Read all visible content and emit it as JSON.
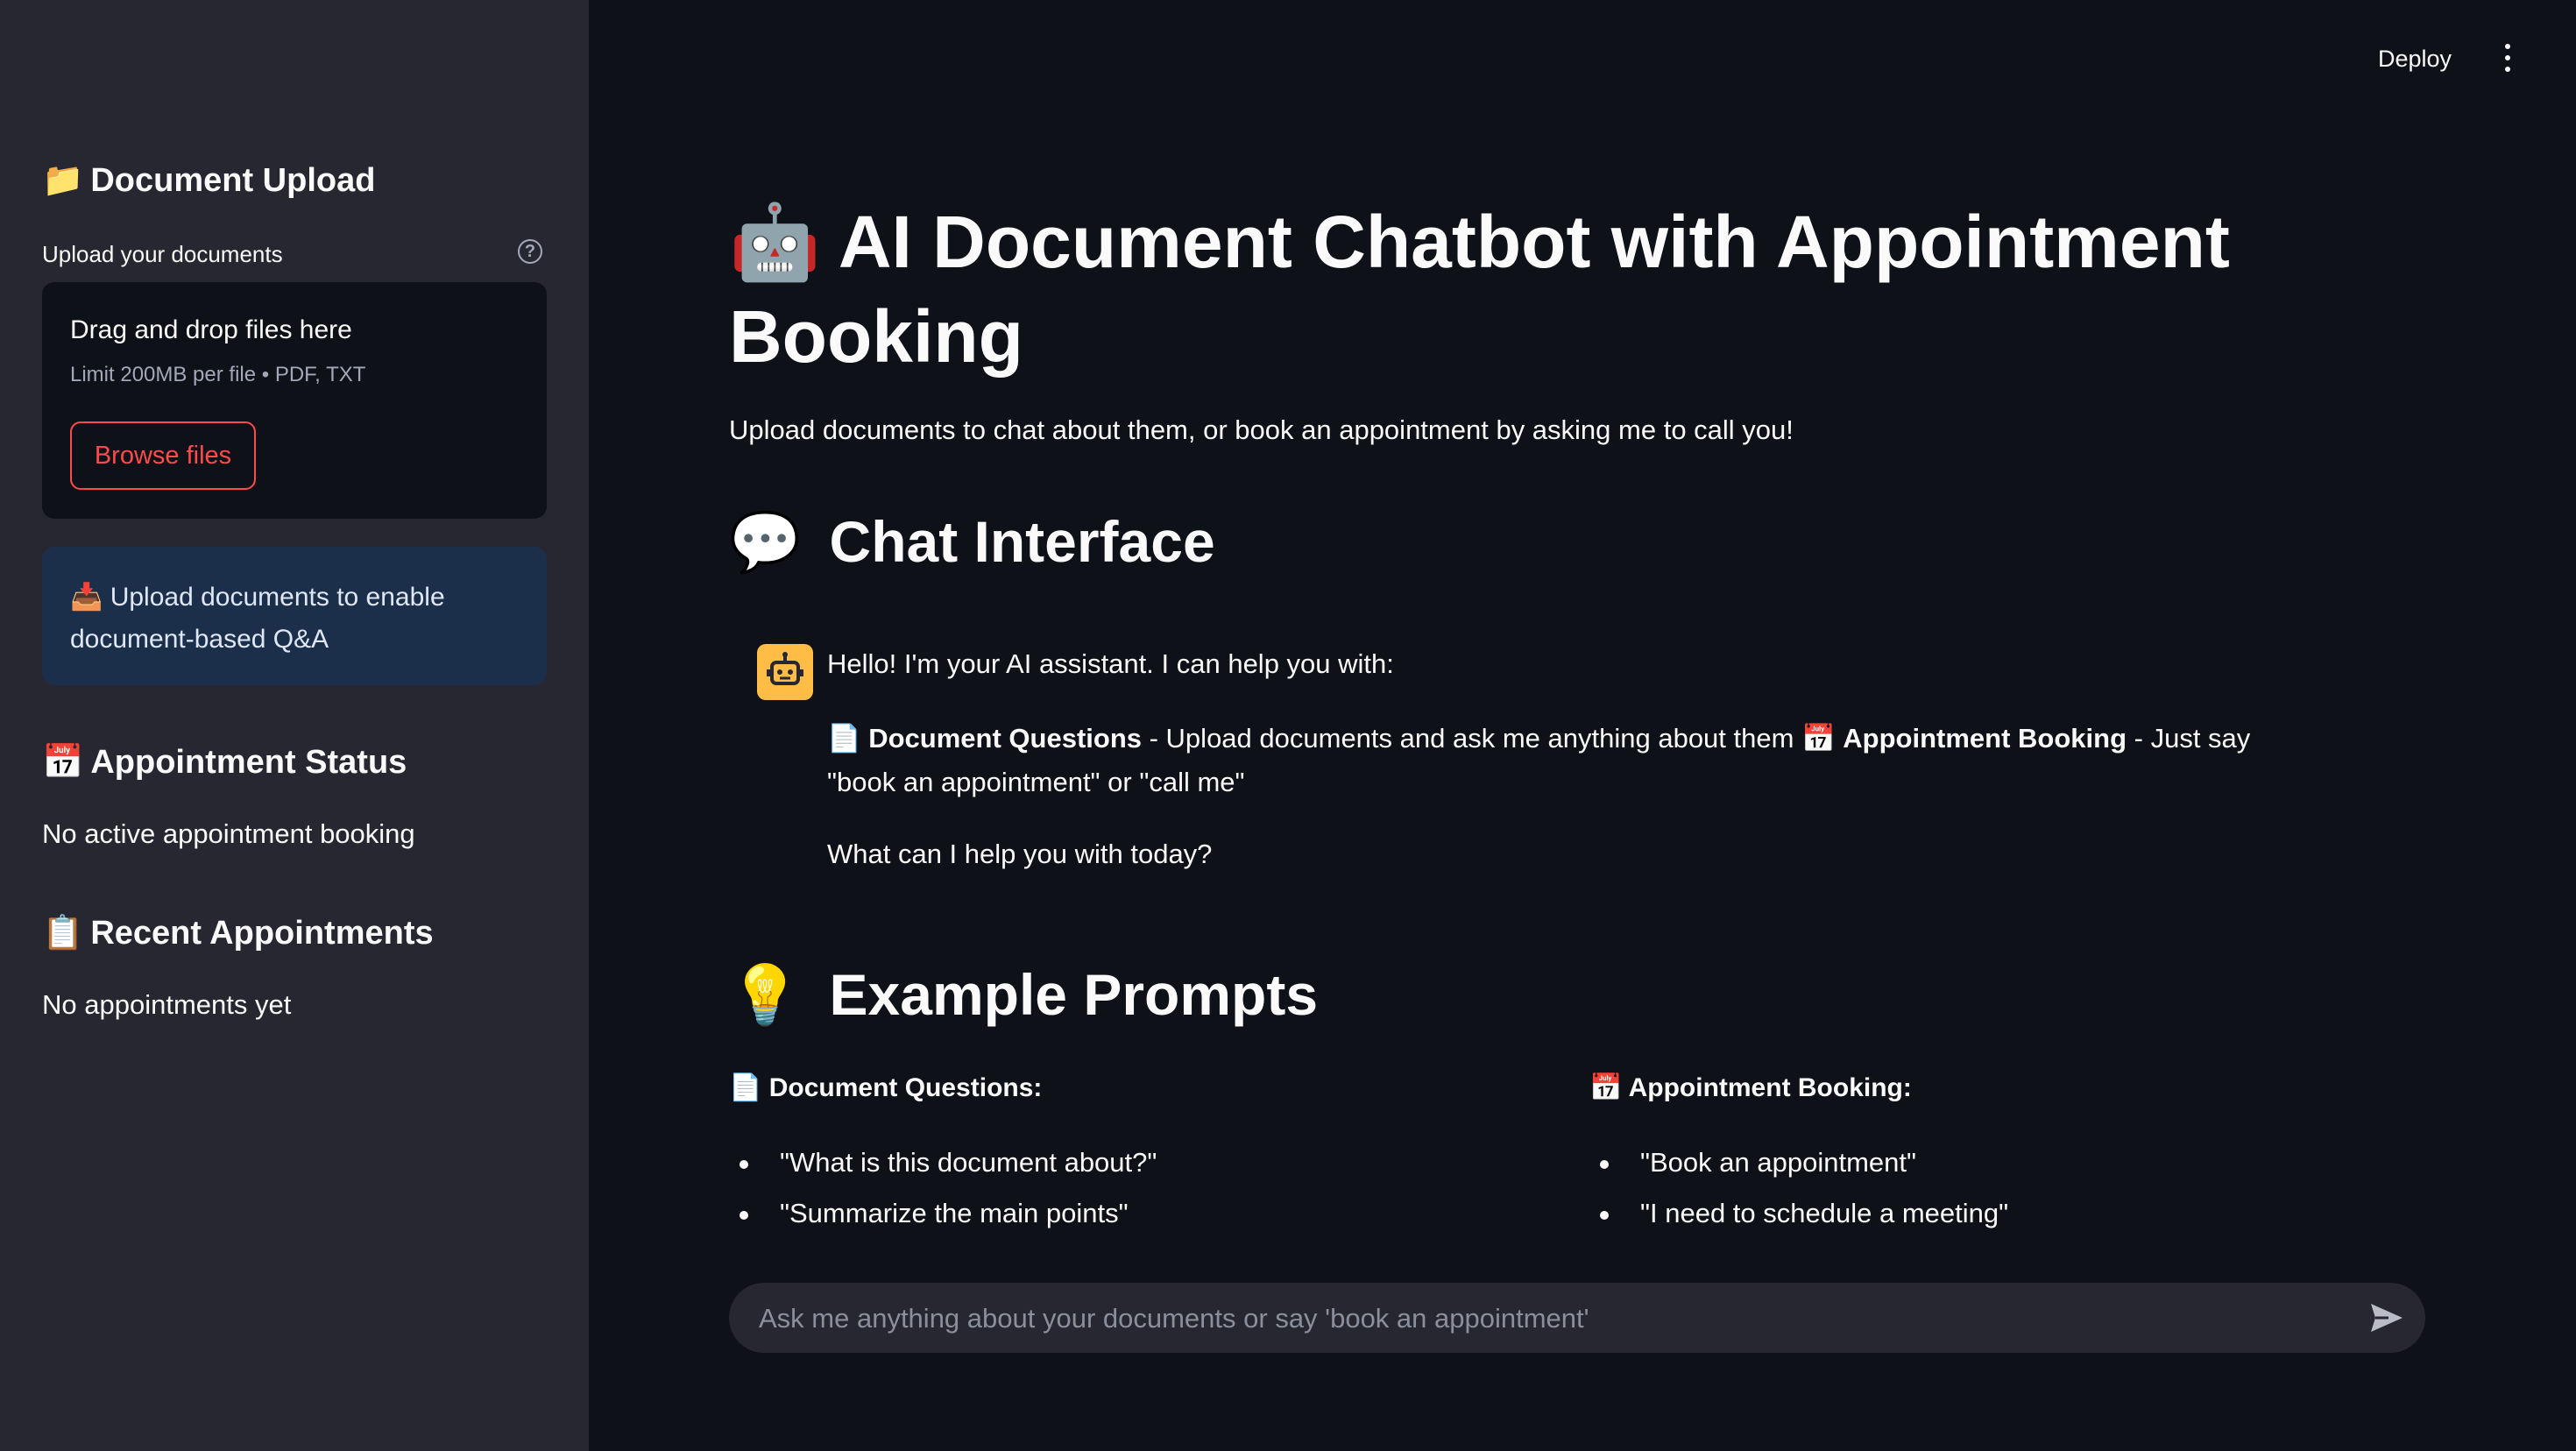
{
  "sidebar": {
    "upload": {
      "icon": "folder-icon",
      "emoji": "📁",
      "heading": "Document Upload",
      "label": "Upload your documents",
      "dropzone_title": "Drag and drop files here",
      "dropzone_limit": "Limit 200MB per file • PDF, TXT",
      "browse_label": "Browse files"
    },
    "info": {
      "icon": "inbox-tray-icon",
      "emoji": "📥",
      "text": "Upload documents to enable document-based Q&A"
    },
    "status": {
      "icon": "calendar-icon",
      "emoji": "📅",
      "heading": "Appointment Status",
      "text": "No active appointment booking"
    },
    "recent": {
      "icon": "clipboard-icon",
      "emoji": "📋",
      "heading": "Recent Appointments",
      "text": "No appointments yet"
    }
  },
  "topbar": {
    "deploy_label": "Deploy",
    "menu_icon": "kebab-menu-icon"
  },
  "main": {
    "title_icon": "robot-icon",
    "title_emoji": "🤖",
    "title": "AI Document Chatbot with Appointment Booking",
    "subtitle": "Upload documents to chat about them, or book an appointment by asking me to call you!",
    "chat_heading_icon": "speech-bubble-icon",
    "chat_heading_emoji": "💬",
    "chat_heading": "Chat Interface",
    "message": {
      "avatar": "assistant-bot-icon",
      "greeting": "Hello! I'm your AI assistant. I can help you with:",
      "doc_emoji": "📄",
      "doc_bold": "Document Questions",
      "doc_text": " - Upload documents and ask me anything about them ",
      "appt_emoji": "📅",
      "appt_bold": "Appointment Booking",
      "appt_text": " - Just say \"book an appointment\" or \"call me\"",
      "closing": "What can I help you with today?"
    },
    "examples_heading_icon": "light-bulb-icon",
    "examples_heading_emoji": "💡",
    "examples_heading": "Example Prompts",
    "doc_col": {
      "emoji": "📄",
      "heading": "Document Questions:",
      "items": [
        "\"What is this document about?\"",
        "\"Summarize the main points\""
      ]
    },
    "appt_col": {
      "emoji": "📅",
      "heading": "Appointment Booking:",
      "items": [
        "\"Book an appointment\"",
        "\"I need to schedule a meeting\""
      ]
    }
  },
  "chat_input": {
    "placeholder": "Ask me anything about your documents or say 'book an appointment'",
    "send_icon": "send-arrow-icon"
  },
  "colors": {
    "primary": "#ff4b4b",
    "background": "#0e1117",
    "sidebar": "#262730",
    "info": "#1c2f4a",
    "avatar": "#ffbd45"
  }
}
